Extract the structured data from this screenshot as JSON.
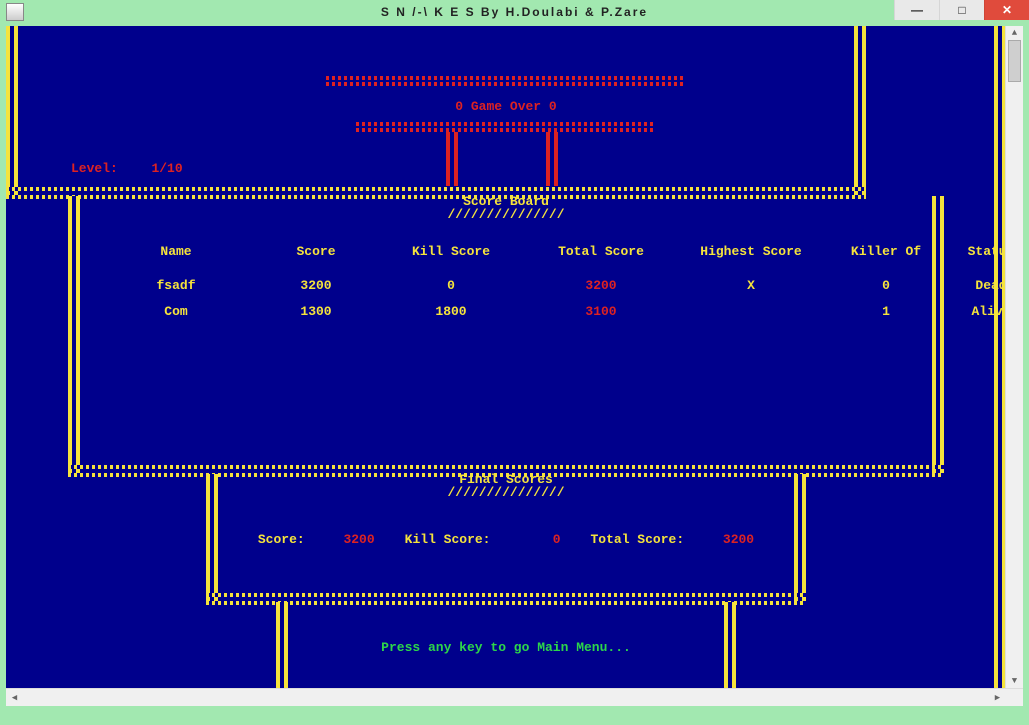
{
  "window": {
    "title": "S N /-\\ K E S  By H.Doulabi & P.Zare",
    "minimize_label": "—",
    "maximize_label": "□",
    "close_label": "✕"
  },
  "game_over_banner": "0 Game Over 0",
  "level_label": "Level:",
  "level_value": "1/10",
  "scoreboard": {
    "title": "Score Board",
    "slash": "///////////////",
    "columns": [
      "Name",
      "Score",
      "Kill Score",
      "Total Score",
      "Highest Score",
      "Killer Of",
      "Status"
    ],
    "rows": [
      {
        "name": "fsadf",
        "score": "3200",
        "kill": "0",
        "total": "3200",
        "highest": "X",
        "killer": "0",
        "status": "Dead"
      },
      {
        "name": "Com",
        "score": "1300",
        "kill": "1800",
        "total": "3100",
        "highest": "",
        "killer": "1",
        "status": "Alive"
      }
    ]
  },
  "final": {
    "title": "Final Scores",
    "slash": "///////////////",
    "score_label": "Score:",
    "score_value": "3200",
    "kill_label": "Kill Score:",
    "kill_value": "0",
    "total_label": "Total Score:",
    "total_value": "3200"
  },
  "prompt": "Press any key to go Main Menu..."
}
